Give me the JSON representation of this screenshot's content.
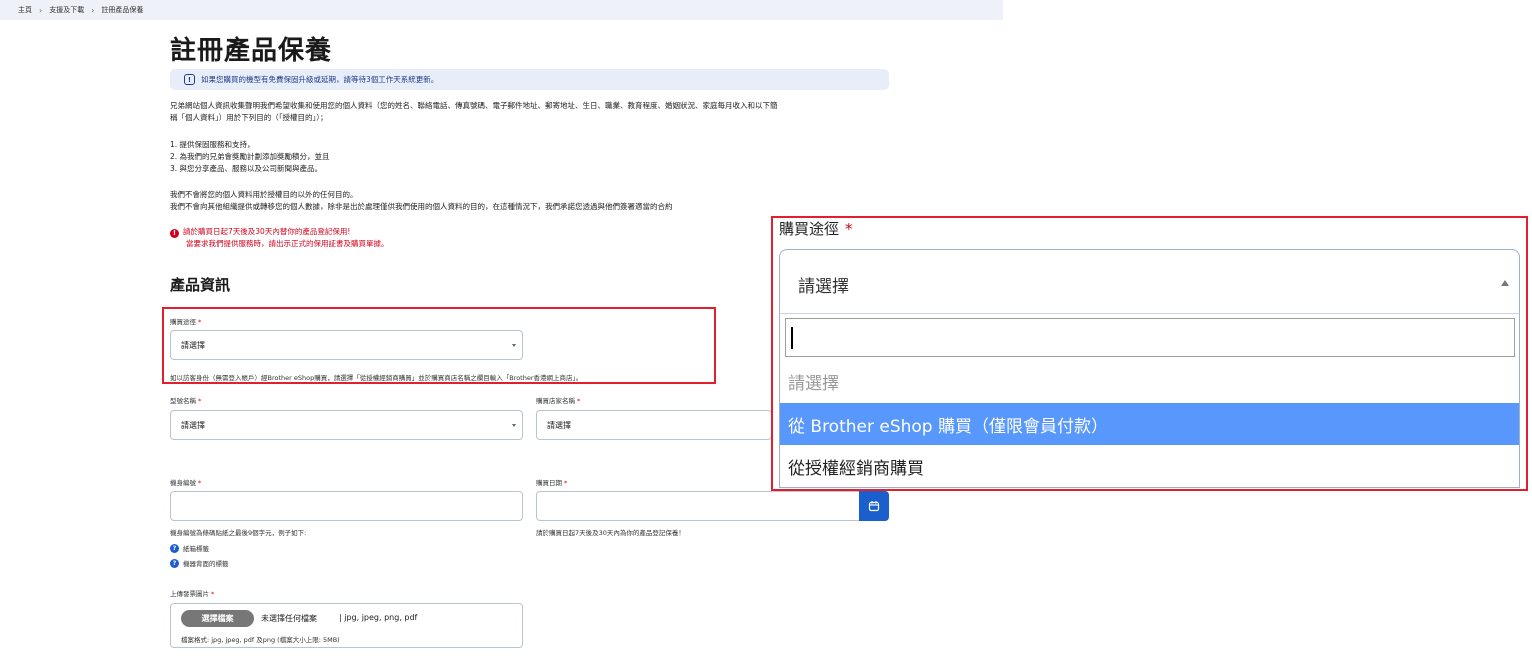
{
  "breadcrumb": {
    "items": [
      "主頁",
      "支援及下載",
      "註冊產品保養"
    ]
  },
  "page": {
    "title": "註冊產品保養",
    "notice": "如果您購買的機型有免費保固升級或延期，請等待3個工作天系統更新。",
    "intro_line1": "兄弟網站個人資訊收集聲明我們希望收集和使用您的個人資料（您的姓名、聯絡電話、傳真號碼、電子郵件地址、郵寄地址、生日、職業、教育程度、婚姻狀況、家庭每月收入和以下簡",
    "intro_line2": "稱「個人資料」）用於下列目的（「授權目的」）；",
    "purpose_1": "1. 提供保固服務和支持，",
    "purpose_2": "2. 為我們的兄弟會獎勵計劃添加獎勵積分，並且",
    "purpose_3": "3. 與您分享產品、服務以及公司新聞與產品。",
    "policy_line1": "我們不會將您的個人資料用於授權目的以外的任何目的。",
    "policy_line2": "我們不會向其他組織提供或轉移您的個人數據，除非是出於處理僅供我們使用的個人資料的目的，在這種情況下，我們承諾您透過與他們簽署適當的合約",
    "warning_line1": "請於購買日起7天後及30天內替你的產品登記保用!",
    "warning_line2": "當要求我們提供服務時，請出示正式的保用証書及購買單據。",
    "section_title": "產品資訊"
  },
  "form": {
    "required_mark": "*",
    "purchase_channel": {
      "label": "購買途徑",
      "value": "請選擇",
      "hint": "如以訪客身份（無需登入帳戶）經Brother eShop購買，請選擇「從授權經銷商購買」並於購買商店名稱之欄目輸入「Brother香港網上商店」。"
    },
    "model_name": {
      "label": "型號名稱",
      "value": "請選擇"
    },
    "store_name": {
      "label": "購買店家名稱",
      "value": "請選擇"
    },
    "serial_number": {
      "label": "機身編號",
      "value": "",
      "hint": "機身編號為條碼貼紙之最後9個字元，例子如下:",
      "help_1": "紙箱標籤",
      "help_2": "機器背面的標籤"
    },
    "purchase_date": {
      "label": "購買日期",
      "value": "",
      "hint": "請於購買日起7天後及30天內為你的產品登記保養！"
    },
    "upload": {
      "label": "上傳發票圖片",
      "button": "選擇檔案",
      "no_file": "未選擇任何檔案",
      "types": "| jpg,  jpeg,  png,  pdf",
      "format_hint": "檔案格式: jpg, jpeg, pdf 及png (檔案大小上限: 5MB)"
    }
  },
  "zoom": {
    "label": "購買途徑",
    "selected": "請選擇",
    "search_value": "",
    "options": [
      "請選擇",
      "從 Brother eShop 購買（僅限會員付款）",
      "從授權經銷商購買"
    ],
    "highlighted_index": 1
  },
  "colors": {
    "accent": "#1a5fcc",
    "required": "#d0021b",
    "highlight_box": "#e0202c",
    "option_active": "#5897fb",
    "notice_bg": "#e8eef9"
  },
  "icons": {
    "notice": "info-icon",
    "warning": "alert-icon",
    "help": "question-icon",
    "calendar": "calendar-icon"
  }
}
